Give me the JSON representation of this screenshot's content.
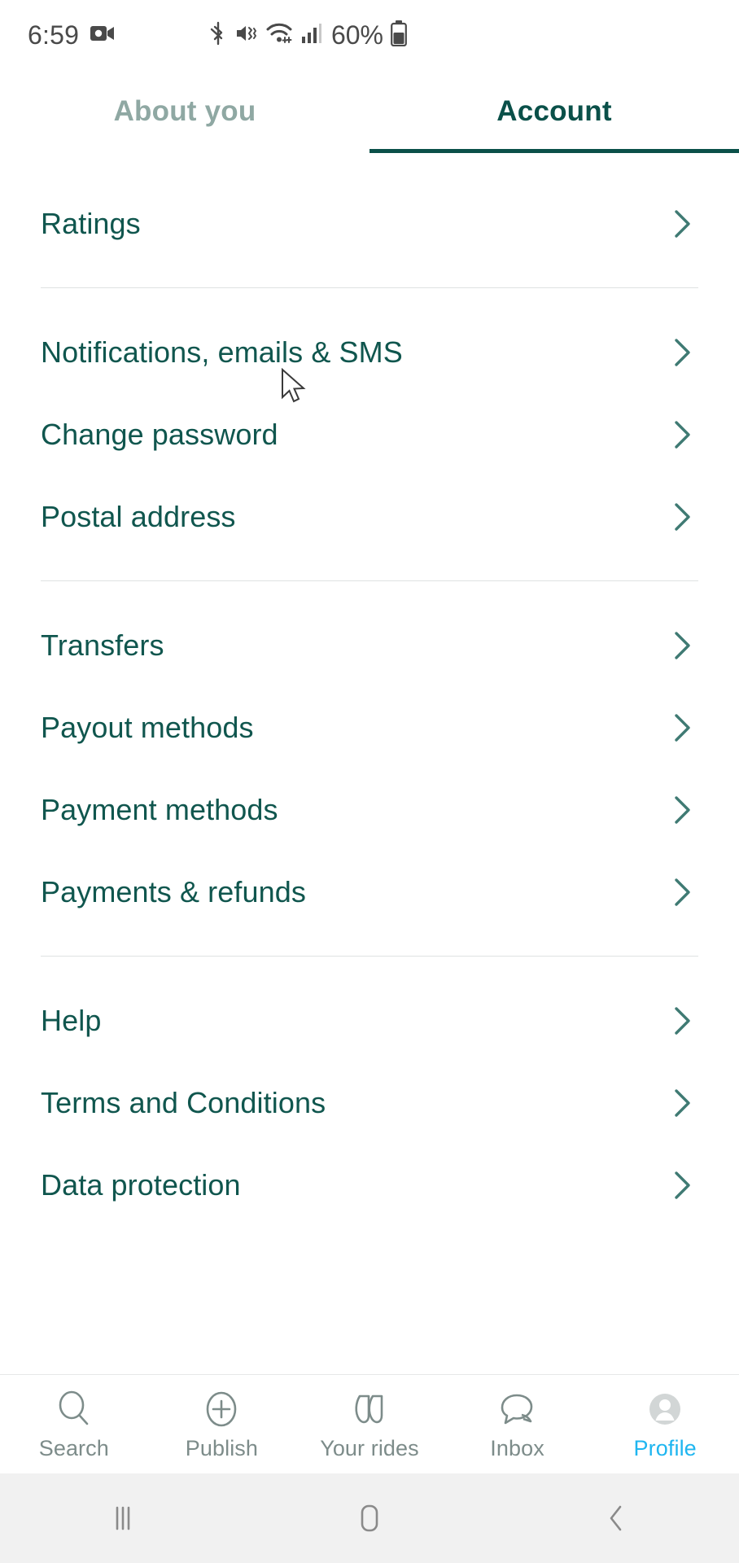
{
  "status_bar": {
    "time": "6:59",
    "left_icons": [
      "video-camera-icon"
    ],
    "right_icons": [
      "bluetooth-icon",
      "mute-vibrate-icon",
      "wifi-icon",
      "cellular-signal-icon"
    ],
    "battery_percent": "60%"
  },
  "tabs": [
    {
      "label": "About you",
      "active": false
    },
    {
      "label": "Account",
      "active": true
    }
  ],
  "menu": {
    "groups": [
      {
        "items": [
          {
            "label": "Ratings"
          }
        ]
      },
      {
        "items": [
          {
            "label": "Notifications, emails & SMS"
          },
          {
            "label": "Change password"
          },
          {
            "label": "Postal address"
          }
        ]
      },
      {
        "items": [
          {
            "label": "Transfers"
          },
          {
            "label": "Payout methods"
          },
          {
            "label": "Payment methods"
          },
          {
            "label": "Payments & refunds"
          }
        ]
      },
      {
        "items": [
          {
            "label": "Help"
          },
          {
            "label": "Terms and Conditions"
          },
          {
            "label": "Data protection"
          }
        ]
      }
    ]
  },
  "bottom_nav": [
    {
      "label": "Search",
      "icon": "search-icon",
      "active": false
    },
    {
      "label": "Publish",
      "icon": "plus-circle-icon",
      "active": false
    },
    {
      "label": "Your rides",
      "icon": "rides-icon",
      "active": false
    },
    {
      "label": "Inbox",
      "icon": "chat-bubbles-icon",
      "active": false
    },
    {
      "label": "Profile",
      "icon": "avatar-icon",
      "active": true
    }
  ],
  "system_nav": [
    {
      "name": "recents-button",
      "icon": "recents-icon"
    },
    {
      "name": "home-button",
      "icon": "home-icon"
    },
    {
      "name": "back-button",
      "icon": "back-icon"
    }
  ],
  "colors": {
    "primary_teal": "#10564e",
    "tab_active": "#0a5049",
    "tab_inactive": "#8fa8a3",
    "nav_active": "#1fb6f0",
    "nav_inactive": "#7d8c8a",
    "divider": "#dfe2e2",
    "status_text": "#4a4a4a"
  }
}
